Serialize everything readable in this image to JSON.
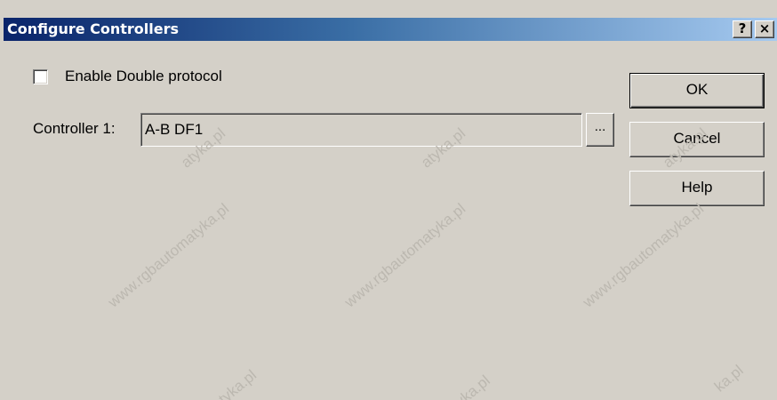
{
  "dialog": {
    "title": "Configure Controllers",
    "help_button": "?",
    "close_button": "×"
  },
  "options": {
    "enable_double_protocol": {
      "label": "Enable Double protocol",
      "checked": false
    }
  },
  "controllers": [
    {
      "label": "Controller 1:",
      "value": "A-B DF1",
      "browse_label": "..."
    }
  ],
  "buttons": {
    "ok": "OK",
    "cancel": "Cancel",
    "help": "Help"
  },
  "watermark": {
    "a": "www.rgbautomatyka.pl",
    "b": "www.rgbautomatyka.pl",
    "c": "www.rgbautomatyka.pl",
    "d": "atyka.pl",
    "e": "atyka.pl",
    "f": "atyka.pl",
    "g": "atyka.pl",
    "h": "tyka.pl",
    "i": "ka.pl"
  },
  "colors": {
    "titlebar_start": "#0a246a",
    "titlebar_end": "#a6caf0",
    "dialog_face": "#d4d0c8"
  }
}
